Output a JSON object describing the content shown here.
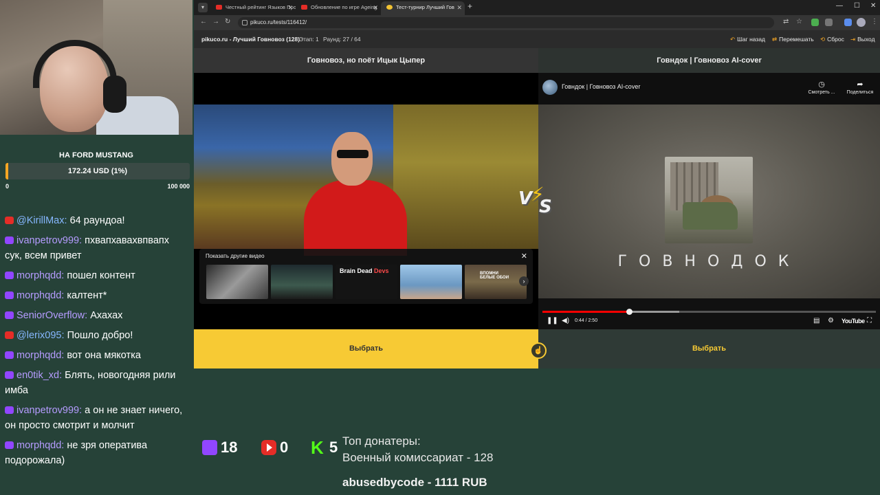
{
  "stream": {
    "goal": {
      "title": "НА FORD MUSTANG",
      "amount": "172.24 USD (1%)",
      "min": "0",
      "max": "100 000",
      "progress_fraction": 0.01
    },
    "chat": [
      {
        "platform": "yt",
        "user": "@KirillMax:",
        "text": "64 раундоа!"
      },
      {
        "platform": "tw",
        "user": "ivanpetrov999:",
        "text": "пхвапхавахвпвапх сук, всем привет"
      },
      {
        "platform": "tw",
        "user": "morphqdd:",
        "text": "пошел контент"
      },
      {
        "platform": "tw",
        "user": "morphqdd:",
        "text": "калтент*"
      },
      {
        "platform": "tw",
        "user": "SeniorOverflow:",
        "text": "Ахахах"
      },
      {
        "platform": "yt",
        "user": "@lerix095:",
        "text": "Пошло добро!"
      },
      {
        "platform": "tw",
        "user": "morphqdd:",
        "text": "вот она мякотка"
      },
      {
        "platform": "tw",
        "user": "en0tik_xd:",
        "text": "Блять, новогодняя рили имба"
      },
      {
        "platform": "tw",
        "user": "ivanpetrov999:",
        "text": "а он не знает ничего, он просто смотрит и молчит"
      },
      {
        "platform": "tw",
        "user": "morphqdd:",
        "text": "не зря оператива подорожала)"
      }
    ],
    "counters": {
      "twitch": "18",
      "youtube": "0",
      "kick_letter": "K",
      "kick": "5"
    },
    "donors": {
      "title": "Топ донатеры:",
      "top": "Военный комиссариат - 128",
      "last": "abusedbycode - 1111 RUB"
    }
  },
  "browser": {
    "tabs": [
      {
        "label": "Честный рейтинг Языков Про",
        "icon": "youtube-favicon"
      },
      {
        "label": "Обновление по игре Ageing",
        "icon": "youtube-favicon"
      },
      {
        "label": "Тест-турнир Лучший Гов",
        "icon": "pikuco-favicon",
        "active": true
      }
    ],
    "url": "pikuco.ru/tests/116412/",
    "colors": {
      "accent": "#f7ca34",
      "youtube_red": "#ff0000",
      "twitch": "#9146ff",
      "kick": "#53fc18"
    }
  },
  "site": {
    "title": "pikuco.ru - Лучший Говновоз (128)",
    "stage": "Этап: 1",
    "round": "Раунд: 27 / 64",
    "actions": {
      "back": "Шаг назад",
      "shuffle": "Перемешать",
      "reset": "Сброс",
      "exit": "Выход"
    },
    "left": {
      "title": "Говновоз, но поёт Ицык Цыпер",
      "suggest_title": "Показать другие видео",
      "thumb_label_a": "Brain Dead",
      "thumb_label_b": "Devs",
      "thumb5_label": "ВПОМНИ БЕЛЫЕ ОБОИ",
      "choose": "Выбрать"
    },
    "right": {
      "title": "Говндок | Говновоз AI-cover",
      "video_title": "Говндок | Говновоз AI-cover",
      "watch_later": "Смотреть ...",
      "share": "Поделиться",
      "big_text": "ГОВНОДОК",
      "time": "0:44 / 2:50",
      "played_fraction": 0.259,
      "buffered_fraction": 0.41,
      "youtube_logo": "YouTube",
      "choose": "Выбрать"
    },
    "vs_v": "V",
    "vs_s": "S"
  }
}
